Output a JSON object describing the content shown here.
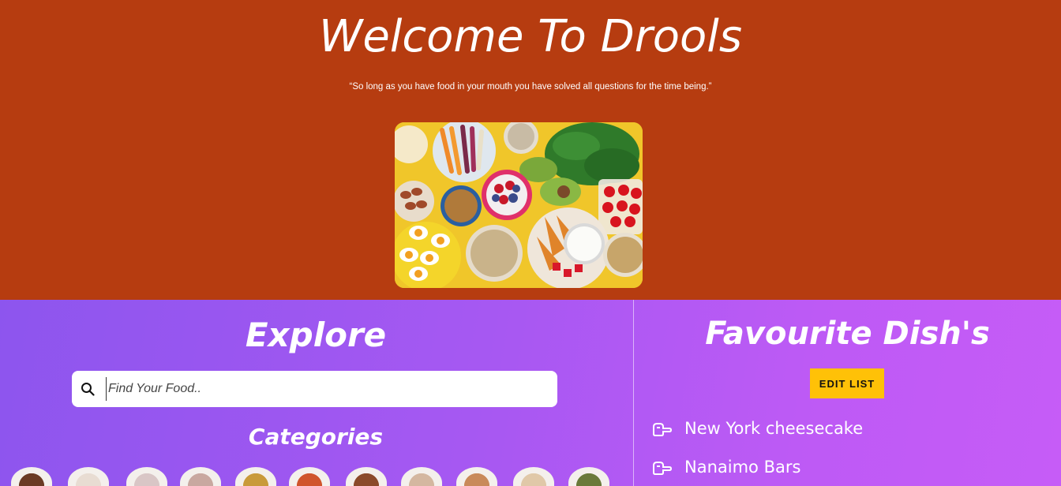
{
  "hero": {
    "title": "Welcome To Drools",
    "quote": "“So long as you have food in your mouth you have solved all questions for the time being.”",
    "image_icon": "food-spread-image"
  },
  "explore": {
    "title": "Explore",
    "search": {
      "placeholder": "Find Your Food..",
      "value": "",
      "icon": "search-icon"
    },
    "categories_title": "Categories",
    "categories": [
      {
        "icon": "steak-icon",
        "color": "#6b3a24"
      },
      {
        "icon": "dumpling-icon",
        "color": "#e8dcd2"
      },
      {
        "icon": "dessert-cup-icon",
        "color": "#d9c6c6"
      },
      {
        "icon": "cake-slice-icon",
        "color": "#c9a8a0"
      },
      {
        "icon": "taco-icon",
        "color": "#c99a3a"
      },
      {
        "icon": "pizza-icon",
        "color": "#d0552c"
      },
      {
        "icon": "burger-icon",
        "color": "#8b4a2a"
      },
      {
        "icon": "sushi-platter-icon",
        "color": "#d4b7a0"
      },
      {
        "icon": "snack-platter-icon",
        "color": "#c98a5a"
      },
      {
        "icon": "bowl-icon",
        "color": "#e0c8a8"
      },
      {
        "icon": "salad-icon",
        "color": "#6a7a3a"
      }
    ]
  },
  "favourites": {
    "title": "Favourite Dish's",
    "edit_label": "EDIT LIST",
    "items": [
      {
        "label": "New York cheesecake",
        "icon": "pointing-hand-icon"
      },
      {
        "label": "Nanaimo Bars",
        "icon": "pointing-hand-icon"
      }
    ]
  },
  "colors": {
    "hero_bg": "#b63c10",
    "gradient_start": "#8d55ee",
    "gradient_end": "#c65cf7",
    "button_accent": "#ffc107"
  }
}
